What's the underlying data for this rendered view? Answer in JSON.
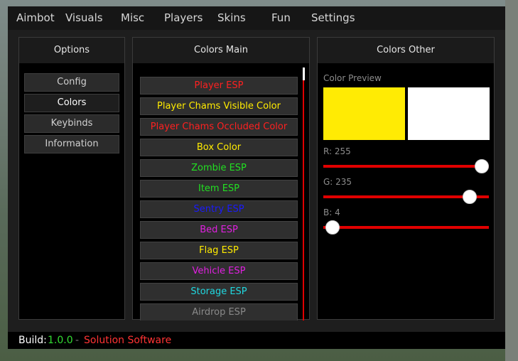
{
  "menu": [
    "Aimbot",
    "Visuals",
    "Misc",
    "Players",
    "Skins",
    "Fun",
    "Settings"
  ],
  "options": {
    "title": "Options",
    "items": [
      "Config",
      "Colors",
      "Keybinds",
      "Information"
    ],
    "active": "Colors"
  },
  "colors_main": {
    "title": "Colors Main",
    "items": [
      {
        "label": "Player ESP",
        "color": "#ff2020"
      },
      {
        "label": "Player Chams Visible Color",
        "color": "#ffeb00"
      },
      {
        "label": "Player Chams Occluded Color",
        "color": "#ff2020"
      },
      {
        "label": "Box Color",
        "color": "#ffeb00"
      },
      {
        "label": "Zombie ESP",
        "color": "#22e022"
      },
      {
        "label": "Item ESP",
        "color": "#22e022"
      },
      {
        "label": "Sentry ESP",
        "color": "#1a1aff"
      },
      {
        "label": "Bed ESP",
        "color": "#e020e0"
      },
      {
        "label": "Flag ESP",
        "color": "#ffeb00"
      },
      {
        "label": "Vehicle ESP",
        "color": "#e020e0"
      },
      {
        "label": "Storage ESP",
        "color": "#20d8e0"
      },
      {
        "label": "Airdrop ESP",
        "color": "#8a8a8a"
      }
    ]
  },
  "colors_other": {
    "title": "Colors Other",
    "preview_label": "Color Preview",
    "preview_color": "#ffeb04",
    "preview_color_2": "#ffffff",
    "r_label": "R: 255",
    "g_label": "G: 235",
    "b_label": "B: 4",
    "r": 255,
    "g": 235,
    "b": 4,
    "slider_max": 255
  },
  "footer": {
    "build_label": "Build:",
    "version": "1.0.0",
    "sep": "-",
    "brand": "Solution Software"
  },
  "theme": {
    "accent": "#e00000",
    "version_color": "#33dd33",
    "brand_color": "#ff3333"
  }
}
